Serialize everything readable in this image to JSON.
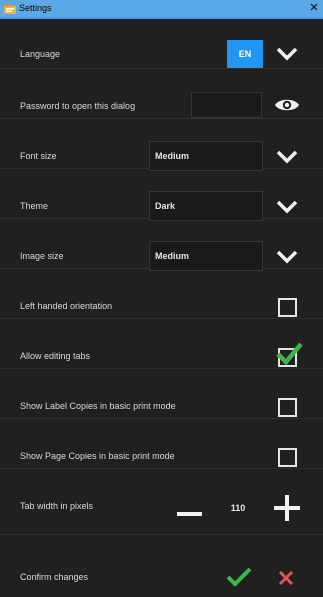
{
  "window": {
    "title": "Settings",
    "close_glyph": "✕",
    "icon": "settings-app-icon",
    "title_bar_color": "#5aa9e6"
  },
  "language": {
    "label": "Language",
    "value": "EN",
    "badge_color": "#2196f3"
  },
  "password": {
    "label": "Password to open this dialog",
    "value": "",
    "toggle_icon": "eye-icon"
  },
  "font_size": {
    "label": "Font size",
    "value": "Medium"
  },
  "theme": {
    "label": "Theme",
    "value": "Dark"
  },
  "image_size": {
    "label": "Image size",
    "value": "Medium"
  },
  "left_handed": {
    "label": "Left handed orientation",
    "checked": false
  },
  "allow_editing_tabs": {
    "label": "Allow editing tabs",
    "checked": true,
    "check_color": "#3cb54a"
  },
  "show_label_copies": {
    "label": "Show Label Copies in basic print mode",
    "checked": false
  },
  "show_page_copies": {
    "label": "Show Page Copies in basic print mode",
    "checked": false
  },
  "tab_width": {
    "label": "Tab width in pixels",
    "value": "110"
  },
  "confirm": {
    "label": "Confirm changes",
    "ok_color": "#3cb54a",
    "cancel_color": "#e05555"
  }
}
